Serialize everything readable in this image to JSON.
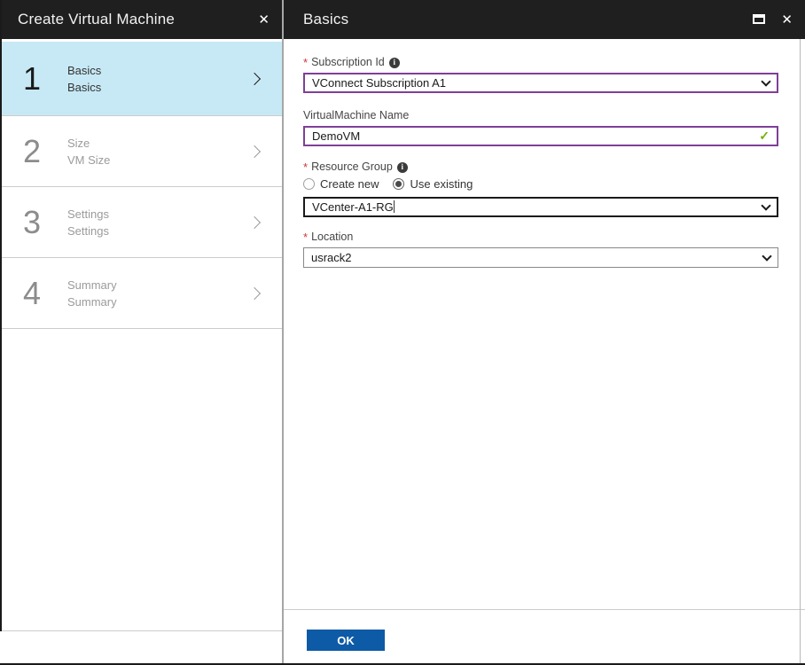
{
  "ui": {
    "required_marker": "*"
  },
  "icons": {
    "close": "✕",
    "check": "✓",
    "info": "i"
  },
  "left_panel": {
    "title": "Create Virtual Machine",
    "steps": [
      {
        "number": "1",
        "title": "Basics",
        "subtitle": "Basics",
        "selected": true
      },
      {
        "number": "2",
        "title": "Size",
        "subtitle": "VM Size",
        "selected": false
      },
      {
        "number": "3",
        "title": "Settings",
        "subtitle": "Settings",
        "selected": false
      },
      {
        "number": "4",
        "title": "Summary",
        "subtitle": "Summary",
        "selected": false
      }
    ]
  },
  "right_panel": {
    "title": "Basics",
    "form": {
      "subscription": {
        "label": "Subscription Id",
        "required": true,
        "value": "VConnect Subscription A1"
      },
      "vm_name": {
        "label": "VirtualMachine Name",
        "required": false,
        "value": "DemoVM"
      },
      "resource_group": {
        "label": "Resource Group",
        "required": true,
        "options": [
          "Create new",
          "Use existing"
        ],
        "selected_option": "Use existing",
        "value": "VCenter-A1-RG"
      },
      "location": {
        "label": "Location",
        "required": true,
        "value": "usrack2"
      }
    },
    "ok_label": "OK"
  },
  "colors": {
    "header_bg": "#1f1f1f",
    "selected_step_bg": "#c7e9f5",
    "valid_purple": "#7f3f98",
    "check_green": "#76b007",
    "required_red": "#d13438",
    "ok_blue": "#0d5aa7"
  }
}
